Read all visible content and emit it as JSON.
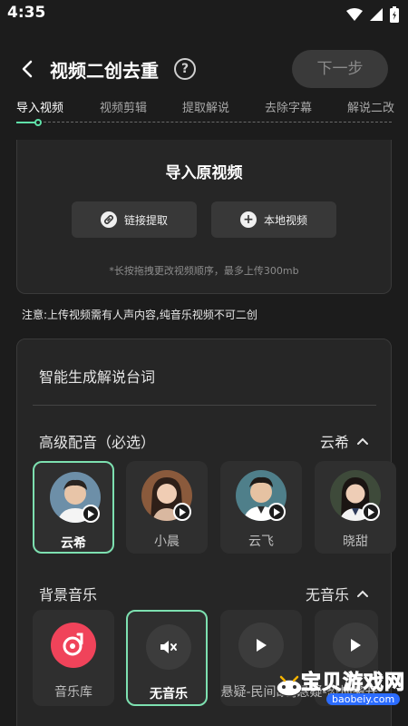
{
  "status_bar": {
    "time": "4:35",
    "icons": [
      "wifi-icon",
      "signal-icon",
      "battery-icon"
    ]
  },
  "header": {
    "back_icon": "chevron-left-icon",
    "title": "视频二创去重",
    "help_icon": "question-circle-icon",
    "next_label": "下一步"
  },
  "tabs": [
    {
      "label": "导入视频",
      "active": true
    },
    {
      "label": "视频剪辑"
    },
    {
      "label": "提取解说"
    },
    {
      "label": "去除字幕"
    },
    {
      "label": "解说二改"
    }
  ],
  "import": {
    "title": "导入原视频",
    "link_button": "链接提取",
    "local_button": "本地视频",
    "hint": "*长按拖拽更改视频顺序，最多上传300mb"
  },
  "notice": "注意:上传视频需有人声内容,纯音乐视频不可二创",
  "generate": {
    "title": "智能生成解说台词",
    "voice_section": {
      "label": "高级配音（必选）",
      "value": "云希"
    },
    "voices": [
      {
        "name": "云希",
        "selected": true
      },
      {
        "name": "小晨"
      },
      {
        "name": "云飞"
      },
      {
        "name": "晓甜"
      }
    ],
    "music_section": {
      "label": "背景音乐",
      "value": "无音乐"
    },
    "music": [
      {
        "name": "音乐库",
        "icon": "music-library-icon"
      },
      {
        "name": "无音乐",
        "icon": "mute-icon",
        "selected": true
      },
      {
        "name": "悬疑-民间故事",
        "icon": "play-icon"
      },
      {
        "name": "悬疑-恐怖袭开",
        "icon": "play-icon"
      }
    ]
  },
  "watermark": {
    "text": "宝贝游戏网",
    "url": "baobeiy.com"
  },
  "colors": {
    "accent": "#7de0b0",
    "background": "#1c1c1c",
    "card": "#262626"
  }
}
